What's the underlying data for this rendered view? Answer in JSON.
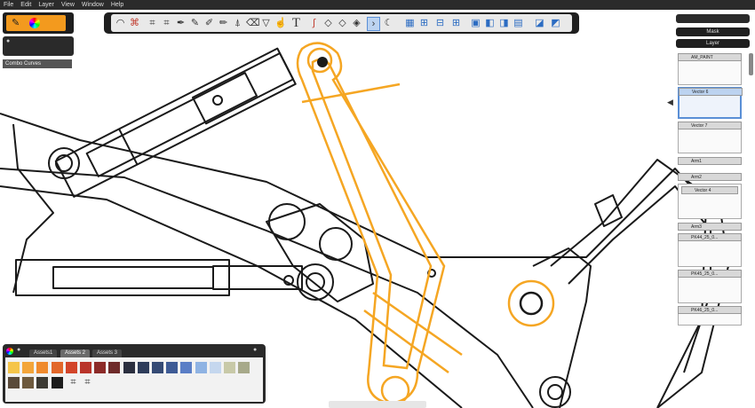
{
  "menu": [
    "File",
    "Edit",
    "Layer",
    "View",
    "Window",
    "Help"
  ],
  "brush_panel": {
    "label": "Combo Curves"
  },
  "toolbar": {
    "icons": [
      "lasso-icon",
      "select-icon",
      "transform-icon",
      "distort-icon",
      "pen-icon",
      "pencil-icon",
      "marker-icon",
      "brush-icon",
      "airbrush-icon",
      "eraser-icon",
      "fill-icon",
      "smudge-icon",
      "text-icon",
      "ellipse-icon",
      "curve-icon",
      "french-curve-icon",
      "ruler-icon",
      "symmetry-icon",
      "layer-icon",
      "layer-add-icon",
      "layer-group-icon",
      "layer-move-icon",
      "layer-copy-icon",
      "image-icon",
      "settings-icon",
      "grid-icon",
      "view-icon"
    ],
    "text_tool_glyph": "T"
  },
  "right_panel": {
    "mask_label": "Mask",
    "layer_label": "Layer",
    "layers": [
      "AM_PAINT",
      "Vector 6",
      "Vector 7",
      "Arm1",
      "Arm2",
      "Vector 4",
      "Arm3",
      "PK44_25_0...",
      "PK45_25_0...",
      "PK46_25_0..."
    ]
  },
  "palette": {
    "tabs": [
      "Assets1",
      "Assets 2",
      "Assets 3"
    ],
    "active_tab": 1,
    "colors_row1": [
      "#f5c54a",
      "#f3a53a",
      "#ef8a2d",
      "#e2672a",
      "#d2452a",
      "#b9342a",
      "#8c2b28",
      "#6e2b2a",
      "#2b2f3f",
      "#2e3c5a",
      "#354a75",
      "#3e5b95",
      "#5a7ec6",
      "#8fb3e3",
      "#c5d7ee",
      "#c8c9a8",
      "#a7a98a"
    ],
    "colors_row2": [
      "#5a4a3a",
      "#6e5a3e",
      "#3c3a33",
      "#1d1d1d"
    ]
  },
  "accent_color": "#f5a623"
}
